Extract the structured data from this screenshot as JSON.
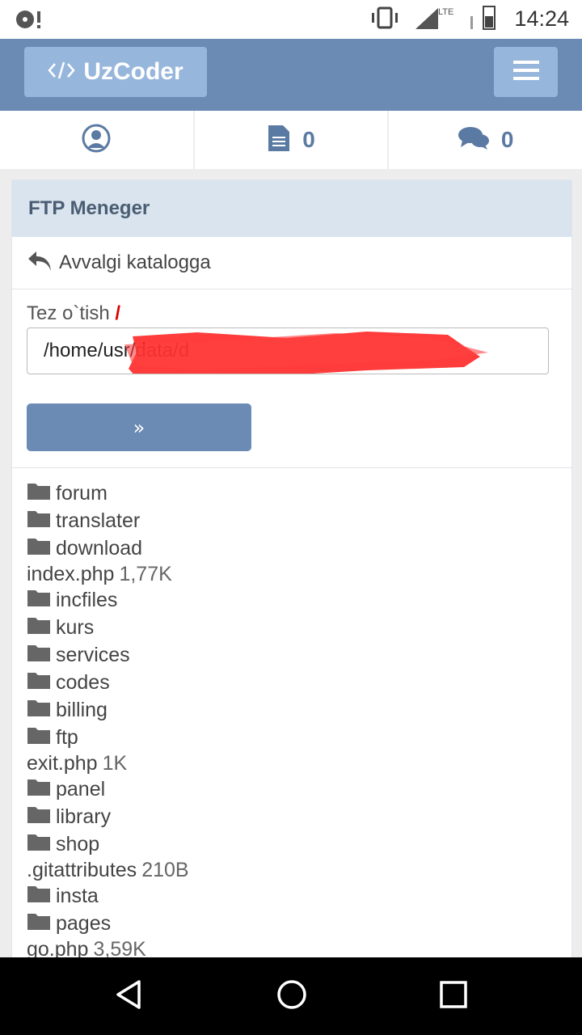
{
  "status_bar": {
    "time": "14:24",
    "network": "LTE",
    "icons": [
      "notification-icon",
      "vibrate-icon",
      "signal-icon",
      "battery-icon"
    ]
  },
  "header": {
    "brand": "UzCoder",
    "brand_icon": "code-icon",
    "menu_icon": "hamburger-menu-icon",
    "color": "#6b8bb4",
    "button_color": "#97b6dc"
  },
  "nav": {
    "profile_icon": "user-circle-icon",
    "files_count": "0",
    "messages_count": "0"
  },
  "panel": {
    "title": "FTP Meneger",
    "back_label": "Avvalgi katalogga",
    "quick_label": "Tez o`tish",
    "quick_slash": "/",
    "path_value": "/home/usr/data/d",
    "go_label": "»"
  },
  "files": [
    {
      "type": "dir",
      "name": "forum"
    },
    {
      "type": "dir",
      "name": "translater"
    },
    {
      "type": "dir",
      "name": "download"
    },
    {
      "type": "file",
      "name": "index.php",
      "size": "1,77K"
    },
    {
      "type": "dir",
      "name": "incfiles"
    },
    {
      "type": "dir",
      "name": "kurs"
    },
    {
      "type": "dir",
      "name": "services"
    },
    {
      "type": "dir",
      "name": "codes"
    },
    {
      "type": "dir",
      "name": "billing"
    },
    {
      "type": "dir",
      "name": "ftp"
    },
    {
      "type": "file",
      "name": "exit.php",
      "size": "1K"
    },
    {
      "type": "dir",
      "name": "panel"
    },
    {
      "type": "dir",
      "name": "library"
    },
    {
      "type": "dir",
      "name": "shop"
    },
    {
      "type": "file",
      "name": ".gitattributes",
      "size": "210B"
    },
    {
      "type": "dir",
      "name": "insta"
    },
    {
      "type": "dir",
      "name": "pages"
    },
    {
      "type": "file",
      "name": "go.php",
      "size": "3,59K"
    }
  ]
}
